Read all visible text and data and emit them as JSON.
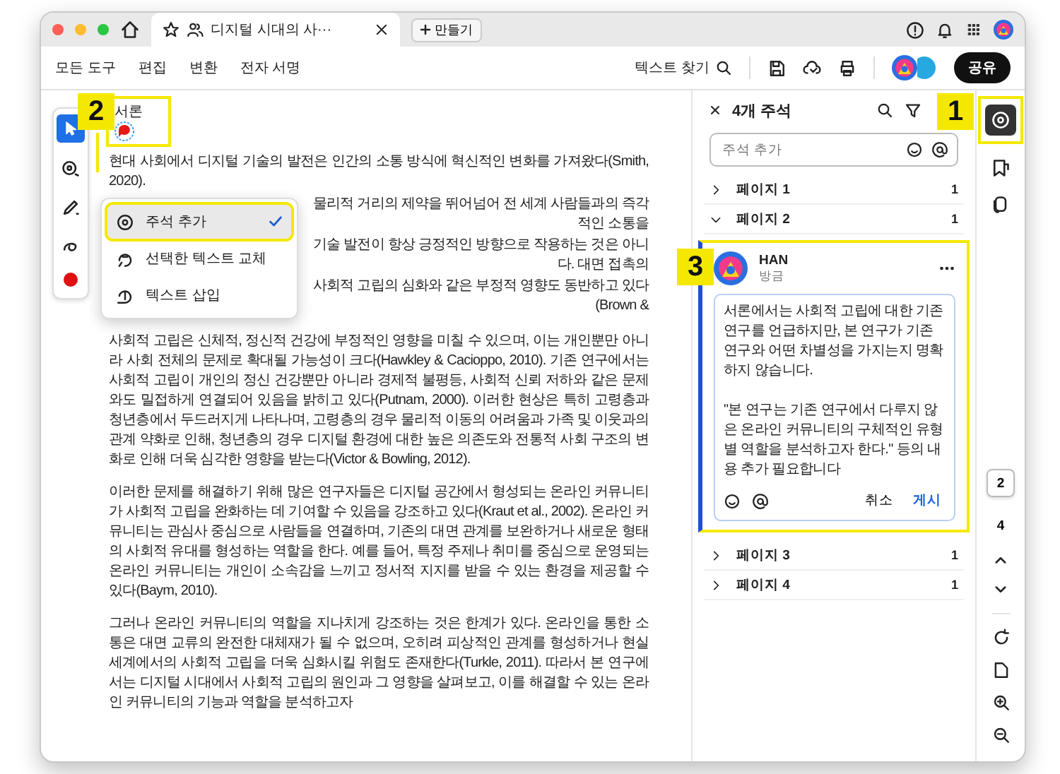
{
  "title_bar": {
    "tab_title": "디지털 시대의 사···",
    "new_tab": "만들기"
  },
  "menu": [
    {
      "label": "모든 도구"
    },
    {
      "label": "편집"
    },
    {
      "label": "변환"
    },
    {
      "label": "전자 서명"
    }
  ],
  "toolbar": {
    "find_text": "텍스트 찾기",
    "share": "공유"
  },
  "tools": [
    {
      "kind": "select",
      "selected": true
    },
    {
      "kind": "comment",
      "selected": false
    },
    {
      "kind": "pen",
      "selected": false
    },
    {
      "kind": "eraser",
      "selected": false
    },
    {
      "kind": "color",
      "selected": false,
      "color": "#e01010"
    }
  ],
  "document": {
    "heading": "서론",
    "first_paragraph_lines": [
      "현대 사회에서 디지털 기술의 발전은 인간의 소통 방식에 혁신적인 변화를 가져왔다(Smith, 2020).",
      "물리적 거리의 제약을 뛰어넘어 전 세계 사람들과의 즉각적인 소통을",
      "기술 발전이 항상 긍정적인 방향으로 작용하는 것은 아니다. 대면 접촉의",
      "사회적 고립의 심화와 같은 부정적 영향도 동반하고 있다(Brown &"
    ],
    "paragraphs": [
      "사회적 고립은 신체적, 정신적 건강에 부정적인 영향을 미칠 수 있으며, 이는 개인뿐만 아니라 사회 전체의 문제로 확대될 가능성이 크다(Hawkley & Cacioppo, 2010). 기존 연구에서는 사회적 고립이 개인의 정신 건강뿐만 아니라 경제적 불평등, 사회적 신뢰 저하와 같은 문제와도 밀접하게 연결되어 있음을 밝히고 있다(Putnam, 2000). 이러한 현상은 특히 고령층과 청년층에서 두드러지게 나타나며, 고령층의 경우 물리적 이동의 어려움과 가족 및 이웃과의 관계 약화로 인해, 청년층의 경우 디지털 환경에 대한 높은 의존도와 전통적 사회 구조의 변화로 인해 더욱 심각한 영향을 받는다(Victor & Bowling, 2012).",
      "이러한 문제를 해결하기 위해 많은 연구자들은 디지털 공간에서 형성되는 온라인 커뮤니티가 사회적 고립을 완화하는 데 기여할 수 있음을 강조하고 있다(Kraut et al., 2002). 온라인 커뮤니티는 관심사 중심으로 사람들을 연결하며, 기존의 대면 관계를 보완하거나 새로운 형태의 사회적 유대를 형성하는 역할을 한다. 예를 들어, 특정 주제나 취미를 중심으로 운영되는 온라인 커뮤니티는 개인이 소속감을 느끼고 정서적 지지를 받을 수 있는 환경을 제공할 수 있다(Baym, 2010).",
      "그러나 온라인 커뮤니티의 역할을 지나치게 강조하는 것은 한계가 있다. 온라인을 통한 소통은 대면 교류의 완전한 대체재가 될 수 없으며, 오히려 피상적인 관계를 형성하거나 현실 세계에서의 사회적 고립을 더욱 심화시킬 위험도 존재한다(Turkle, 2011). 따라서 본 연구에서는 디지털 시대에서 사회적 고립의 원인과 그 영향을 살펴보고, 이를 해결할 수 있는 온라인 커뮤니티의 기능과 역할을 분석하고자"
    ]
  },
  "context_menu": [
    {
      "kind": "comment",
      "label": "주석 추가",
      "checked": true
    },
    {
      "kind": "replace",
      "label": "선택한 텍스트 교체",
      "checked": false
    },
    {
      "kind": "insert",
      "label": "텍스트 삽입",
      "checked": false
    }
  ],
  "comments_panel": {
    "title": "4개 주석",
    "placeholder": "주석 추가",
    "pages": [
      {
        "label": "페이지 1",
        "count": "1",
        "expanded": false
      },
      {
        "label": "페이지 2",
        "count": "1",
        "expanded": true,
        "comment": {
          "author": "HAN",
          "status": "방금",
          "value": "서론에서는 사회적 고립에 대한 기존 연구를 언급하지만, 본 연구가 기존 연구와 어떤 차별성을 가지는지 명확하지 않습니다.\n\n\"본 연구는 기존 연구에서 다루지 않은 온라인 커뮤니티의 구체적인 유형별 역할을 분석하고자 한다.\" 등의 내용 추가 필요합니다",
          "cancel": "취소",
          "post": "게시"
        }
      },
      {
        "label": "페이지 3",
        "count": "1",
        "expanded": false
      },
      {
        "label": "페이지 4",
        "count": "1",
        "expanded": false
      }
    ]
  },
  "page_rail": [
    {
      "label": "2",
      "selected": true
    },
    {
      "label": "4",
      "selected": false
    }
  ],
  "callouts": [
    {
      "label": "1"
    },
    {
      "label": "2"
    },
    {
      "label": "3"
    }
  ]
}
